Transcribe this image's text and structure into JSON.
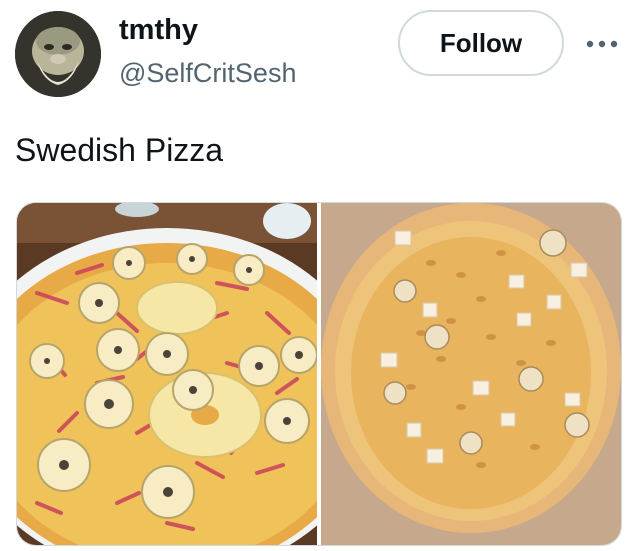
{
  "author": {
    "display_name": "tmthy",
    "handle": "@SelfCritSesh"
  },
  "actions": {
    "follow_label": "Follow"
  },
  "tweet": {
    "text": "Swedish Pizza"
  },
  "media": [
    {
      "icon": "pizza-banana-pineapple-ham-photo"
    },
    {
      "icon": "pizza-banana-peanut-photo"
    }
  ],
  "colors": {
    "text_primary": "#0f1419",
    "text_secondary": "#536471",
    "border": "#cfd9de"
  }
}
